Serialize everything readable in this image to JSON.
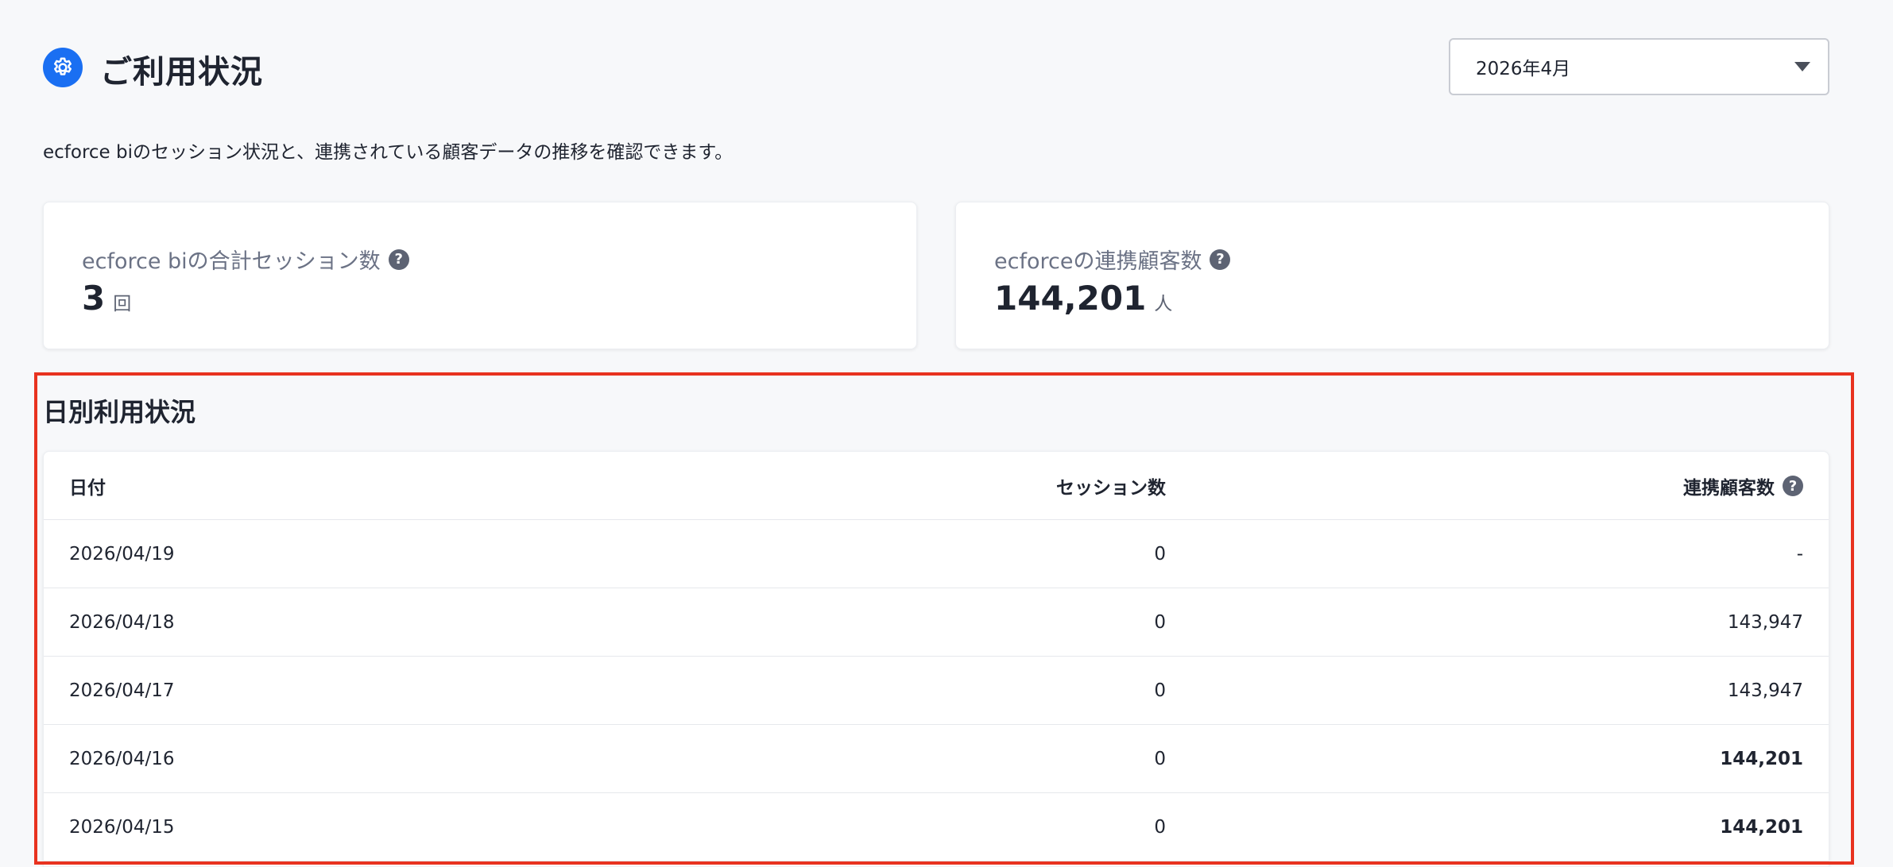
{
  "header": {
    "title": "ご利用状況",
    "icon": "gear-icon",
    "month_select": {
      "value": "2026年4月"
    }
  },
  "description": "ecforce biのセッション状況と、連携されている顧客データの推移を確認できます。",
  "cards": [
    {
      "label": "ecforce biの合計セッション数",
      "value": "3",
      "unit": "回"
    },
    {
      "label": "ecforceの連携顧客数",
      "value": "144,201",
      "unit": "人"
    }
  ],
  "daily": {
    "title": "日別利用状況",
    "columns": {
      "date": "日付",
      "sessions": "セッション数",
      "customers": "連携顧客数"
    },
    "rows": [
      {
        "date": "2026/04/19",
        "sessions": "0",
        "customers": "-"
      },
      {
        "date": "2026/04/18",
        "sessions": "0",
        "customers": "143,947"
      },
      {
        "date": "2026/04/17",
        "sessions": "0",
        "customers": "143,947"
      },
      {
        "date": "2026/04/16",
        "sessions": "0",
        "customers": "144,201"
      },
      {
        "date": "2026/04/15",
        "sessions": "0",
        "customers": "144,201"
      }
    ]
  },
  "colors": {
    "accent": "#1a6ff2",
    "highlight": "#e8321f"
  }
}
